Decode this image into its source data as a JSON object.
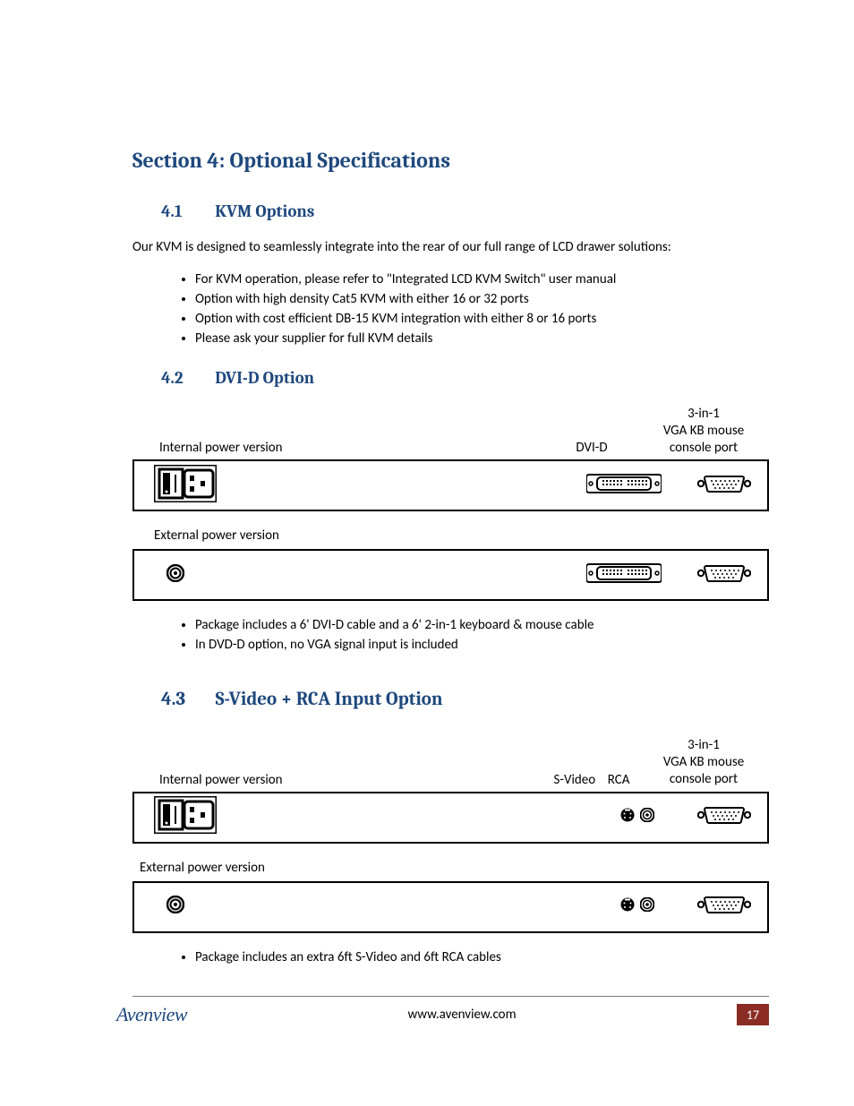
{
  "section": {
    "title": "Section 4: Optional Specifications",
    "s41": {
      "num": "4.1",
      "title": "KVM Options"
    },
    "s42": {
      "num": "4.2",
      "title": "DVI-D Option"
    },
    "s43": {
      "num": "4.3",
      "title": "S-Video + RCA Input Option"
    }
  },
  "intro41": "Our KVM is designed to seamlessly integrate into the rear of our full range of LCD drawer solutions:",
  "bullets41": [
    "For KVM operation, please refer to \"Integrated LCD KVM Switch\" user manual",
    "Option with high density Cat5 KVM with either 16 or 32 ports",
    "Option with cost efficient DB-15 KVM integration with either 8 or 16 ports",
    "Please ask your supplier for full KVM details"
  ],
  "labels": {
    "internal": "Internal power version",
    "external": "External power version",
    "dvid": "DVI-D",
    "svideo": "S-Video",
    "rca": "RCA",
    "console1": "3-in-1",
    "console2": "VGA KB mouse",
    "console3": "console port"
  },
  "bullets42": [
    "Package includes a 6' DVI-D cable and a 6' 2-in-1 keyboard & mouse cable",
    "In DVD-D option, no VGA signal input is included"
  ],
  "bullets43": [
    "Package includes an extra 6ft S-Video and 6ft RCA cables"
  ],
  "footer": {
    "logo": "Avenview",
    "url": "www.avenview.com",
    "page": "17"
  }
}
